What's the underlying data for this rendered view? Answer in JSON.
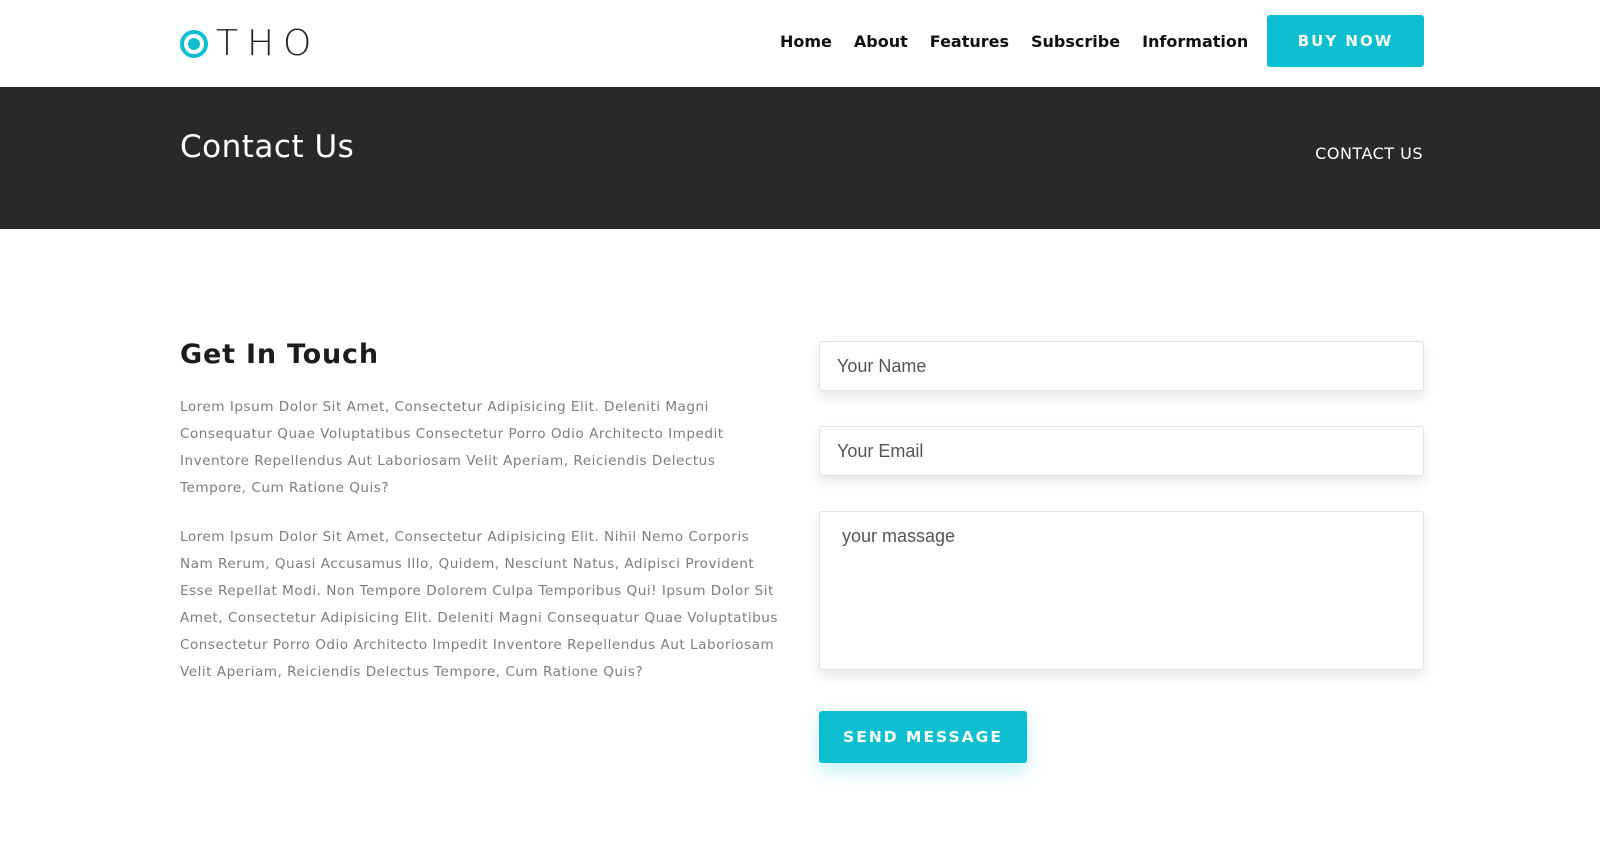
{
  "brand": {
    "name": "THO",
    "accent_color": "#0bbfd0",
    "logo_icon": "ring-dot-icon"
  },
  "nav": {
    "items": [
      {
        "label": "Home"
      },
      {
        "label": "About"
      },
      {
        "label": "Features"
      },
      {
        "label": "Subscribe"
      },
      {
        "label": "Information"
      }
    ],
    "buy_label": "BUY NOW"
  },
  "banner": {
    "title": "Contact Us",
    "breadcrumb": "CONTACT US",
    "background_color": "#292929"
  },
  "contact": {
    "heading": "Get In Touch",
    "paragraphs": [
      "Lorem Ipsum Dolor Sit Amet, Consectetur Adipisicing Elit. Deleniti Magni Consequatur Quae Voluptatibus Consectetur Porro Odio Architecto Impedit Inventore Repellendus Aut Laboriosam Velit Aperiam, Reiciendis Delectus Tempore, Cum Ratione Quis?",
      "Lorem Ipsum Dolor Sit Amet, Consectetur Adipisicing Elit. Nihil Nemo Corporis Nam Rerum, Quasi Accusamus Illo, Quidem, Nesciunt Natus, Adipisci Provident Esse Repellat Modi. Non Tempore Dolorem Culpa Temporibus Qui! Ipsum Dolor Sit Amet, Consectetur Adipisicing Elit. Deleniti Magni Consequatur Quae Voluptatibus Consectetur Porro Odio Architecto Impedit Inventore Repellendus Aut Laboriosam Velit Aperiam, Reiciendis Delectus Tempore, Cum Ratione Quis?"
    ]
  },
  "form": {
    "name_placeholder": "Your Name",
    "email_placeholder": "Your Email",
    "message_placeholder": "your massage",
    "name_value": "",
    "email_value": "",
    "message_value": "",
    "send_label": "SEND MESSAGE"
  }
}
